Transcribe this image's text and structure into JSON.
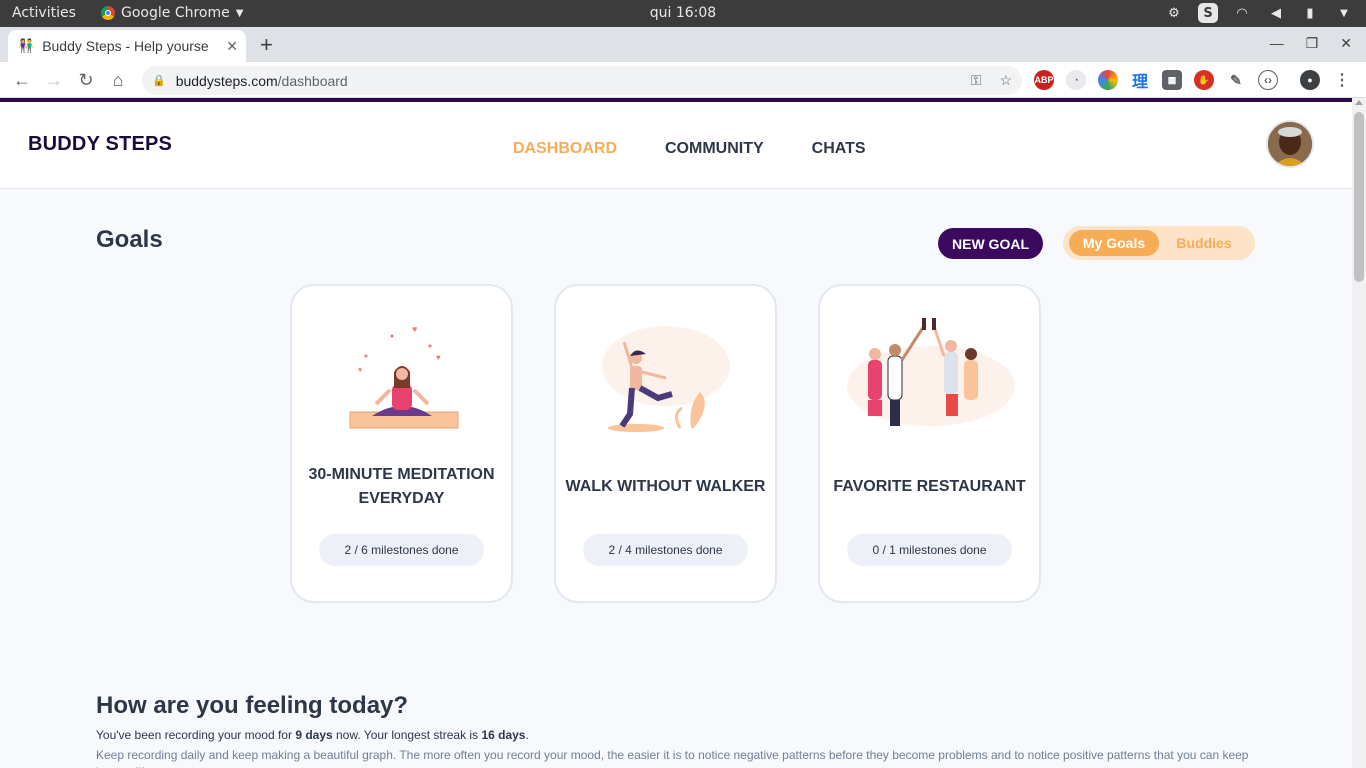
{
  "os": {
    "activities": "Activities",
    "app_name": "Google Chrome",
    "clock": "qui 16:08"
  },
  "browser": {
    "tab_title": "Buddy Steps - Help yourse",
    "url_host": "buddysteps.com",
    "url_path": "/dashboard"
  },
  "header": {
    "logo": "BUDDY STEPS",
    "nav": [
      "DASHBOARD",
      "COMMUNITY",
      "CHATS"
    ],
    "active_nav": "DASHBOARD"
  },
  "goals": {
    "title": "Goals",
    "new_goal": "NEW GOAL",
    "toggle": {
      "mine": "My Goals",
      "buddies": "Buddies"
    },
    "cards": [
      {
        "title_line1": "30-MINUTE MEDITATION",
        "title_line2": "EVERYDAY",
        "milestones": "2 / 6 milestones done"
      },
      {
        "title_line1": "WALK WITHOUT WALKER",
        "title_line2": "",
        "milestones": "2 / 4 milestones done"
      },
      {
        "title_line1": "FAVORITE RESTAURANT",
        "title_line2": "",
        "milestones": "0 / 1 milestones done"
      }
    ]
  },
  "mood": {
    "title": "How are you feeling today?",
    "p1_a": "You've been recording your mood for ",
    "p1_days": "9 days",
    "p1_b": " now. Your longest streak is ",
    "p1_streak": "16 days",
    "p1_c": ".",
    "p2": "Keep recording daily and keep making a beautiful graph. The more often you record your mood, the easier it is to notice negative patterns before they become problems and to notice positive patterns that you can keep in your life."
  },
  "colors": {
    "accent": "#f6ad55",
    "brand_purple": "#3b0a5f",
    "text": "#2d3748"
  }
}
